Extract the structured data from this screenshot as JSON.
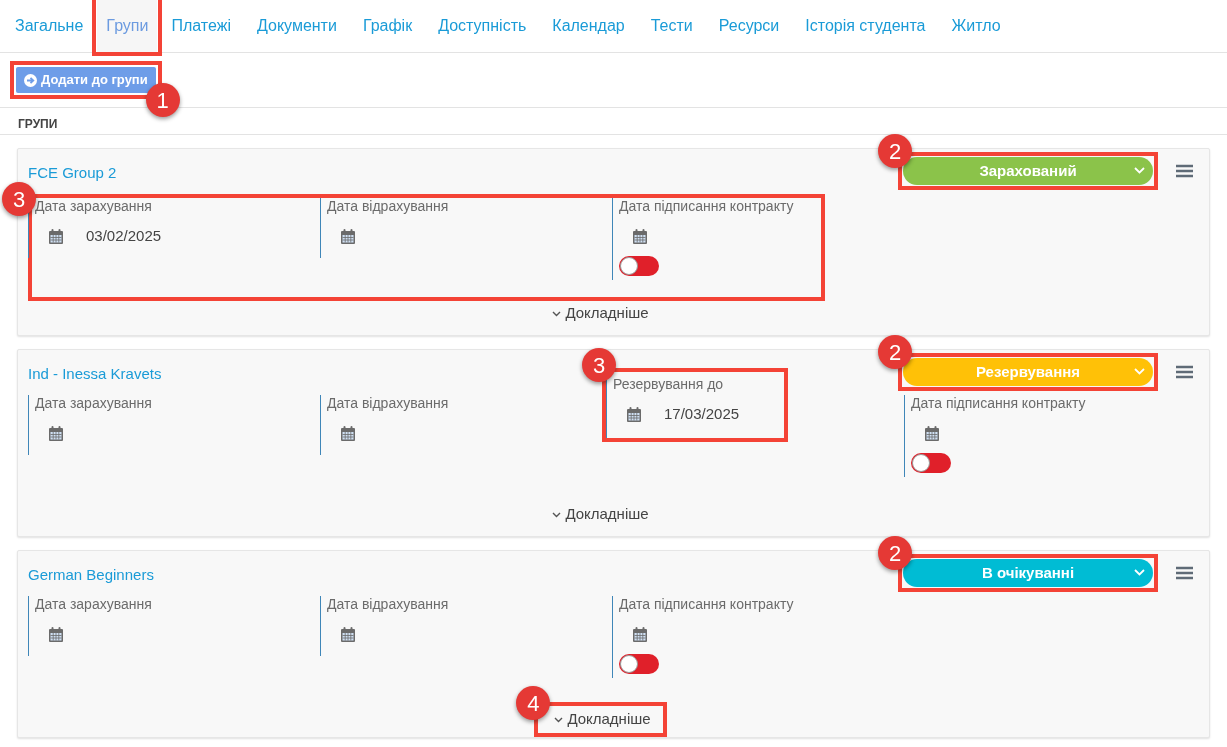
{
  "tabs": [
    {
      "label": "Загальне",
      "selected": false,
      "highlighted": false
    },
    {
      "label": "Групи",
      "selected": true,
      "highlighted": true
    },
    {
      "label": "Платежі",
      "selected": false,
      "highlighted": false
    },
    {
      "label": "Документи",
      "selected": false,
      "highlighted": false
    },
    {
      "label": "Графік",
      "selected": false,
      "highlighted": false
    },
    {
      "label": "Доступність",
      "selected": false,
      "highlighted": false
    },
    {
      "label": "Календар",
      "selected": false,
      "highlighted": false
    },
    {
      "label": "Тести",
      "selected": false,
      "highlighted": false
    },
    {
      "label": "Ресурси",
      "selected": false,
      "highlighted": false
    },
    {
      "label": "Історія студента",
      "selected": false,
      "highlighted": false
    },
    {
      "label": "Житло",
      "selected": false,
      "highlighted": false
    }
  ],
  "add_button": {
    "label": "Додати до групи",
    "callout": "1"
  },
  "section_title": "ГРУПИ",
  "groups": [
    {
      "name": "FCE Group 2",
      "status": {
        "label": "Зарахований",
        "color": "#8bc34a",
        "callout": "2"
      },
      "fields_callout": "3",
      "fields": [
        {
          "kind": "date",
          "label": "Дата зарахування",
          "value": "03/02/2025"
        },
        {
          "kind": "date",
          "label": "Дата відрахування"
        },
        {
          "kind": "contract",
          "label": "Дата підписання контракту",
          "on": false
        }
      ],
      "more": {
        "label": "Докладніше"
      }
    },
    {
      "name": "Ind - Inessa Kravets",
      "status": {
        "label": "Резервування",
        "color": "#ffc107",
        "callout": "2"
      },
      "fields": [
        {
          "kind": "date",
          "label": "Дата зарахування"
        },
        {
          "kind": "date",
          "label": "Дата відрахування"
        },
        {
          "kind": "date",
          "label": "Резервування до",
          "value": "17/03/2025",
          "callout": "3"
        },
        {
          "kind": "contract",
          "label": "Дата підписання контракту",
          "on": false
        }
      ],
      "more": {
        "label": "Докладніше"
      }
    },
    {
      "name": "German Beginners",
      "status": {
        "label": "В очікуванні",
        "color": "#00bcd4",
        "callout": "2"
      },
      "fields": [
        {
          "kind": "date",
          "label": "Дата зарахування"
        },
        {
          "kind": "date",
          "label": "Дата відрахування"
        },
        {
          "kind": "contract",
          "label": "Дата підписання контракту",
          "on": false
        }
      ],
      "more": {
        "label": "Докладніше",
        "callout": "4"
      }
    }
  ]
}
